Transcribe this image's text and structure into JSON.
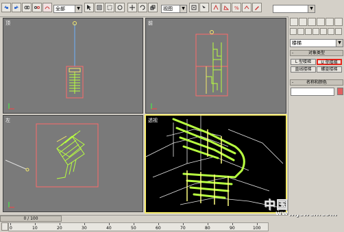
{
  "toolbar": {
    "selection_filter": "全部",
    "ref_coord": "视图",
    "named_selection": ""
  },
  "viewports": {
    "top": {
      "label": "顶"
    },
    "front": {
      "label": "前"
    },
    "left": {
      "label": "左"
    },
    "perspective": {
      "label": "透视"
    }
  },
  "panel": {
    "category_dropdown": "楼梯",
    "object_type_header": "对象类型",
    "buttons": [
      "L 型楼梯",
      "U 型楼梯",
      "直线楼梯",
      "螺旋楼梯"
    ],
    "name_color_header": "名称和颜色",
    "name_value": "",
    "color_swatch": "#e06060"
  },
  "timeline": {
    "frame_display": "0 / 100",
    "ticks": [
      "0",
      "10",
      "20",
      "30",
      "40",
      "50",
      "60",
      "70",
      "80",
      "90",
      "100"
    ]
  },
  "watermark": {
    "text": "中国教程网",
    "url": "www.jcwcn.com"
  }
}
